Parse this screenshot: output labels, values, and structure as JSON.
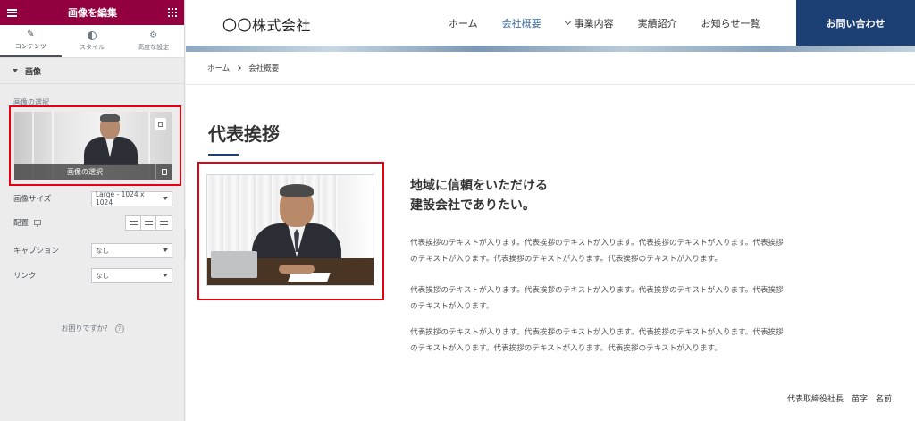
{
  "panel": {
    "title": "画像を編集",
    "tabs": [
      {
        "label": "コンテンツ",
        "icon": "pencil-icon"
      },
      {
        "label": "スタイル",
        "icon": "half-circle-icon"
      },
      {
        "label": "高度な設定",
        "icon": "gear-icon"
      }
    ],
    "section_title": "画像",
    "image_choose_label": "画像の選択",
    "media_button_label": "画像の選択",
    "image_size": {
      "label": "画像サイズ",
      "value": "Large - 1024 x 1024"
    },
    "alignment": {
      "label": "配置"
    },
    "caption": {
      "label": "キャプション",
      "value": "なし"
    },
    "link": {
      "label": "リンク",
      "value": "なし"
    },
    "help_text": "お困りですか？",
    "help_glyph": "?",
    "collapse_glyph": "‹"
  },
  "site": {
    "logo": "〇〇株式会社",
    "nav": [
      {
        "label": "ホーム",
        "current": false
      },
      {
        "label": "会社概要",
        "current": true
      },
      {
        "label": "事業内容",
        "current": false,
        "dropdown": true
      },
      {
        "label": "実績紹介",
        "current": false
      },
      {
        "label": "お知らせ一覧",
        "current": false
      }
    ],
    "contact_label": "お問い合わせ",
    "accent_color": "#1c3f74",
    "current_nav_color": "#3a6aa0"
  },
  "breadcrumb": {
    "home": "ホーム",
    "current": "会社概要"
  },
  "content": {
    "page_title": "代表挨拶",
    "headline_line1": "地域に信頼をいただける",
    "headline_line2": "建設会社でありたい。",
    "paragraphs": [
      {
        "line1": "代表挨拶のテキストが入ります。代表挨拶のテキストが入ります。代表挨拶のテキストが入ります。代表挨拶",
        "line2": "のテキストが入ります。代表挨拶のテキストが入ります。代表挨拶のテキストが入ります。"
      },
      {
        "line1": "代表挨拶のテキストが入ります。代表挨拶のテキストが入ります。代表挨拶のテキストが入ります。代表挨拶",
        "line2": "のテキストが入ります。"
      },
      {
        "line1": "代表挨拶のテキストが入ります。代表挨拶のテキストが入ります。代表挨拶のテキストが入ります。代表挨拶",
        "line2": "のテキストが入ります。代表挨拶のテキストが入ります。代表挨拶のテキストが入ります。"
      }
    ],
    "signature": "代表取締役社長　苗字　名前"
  },
  "highlight_color": "#e60012",
  "panel_header_color": "#93003f"
}
